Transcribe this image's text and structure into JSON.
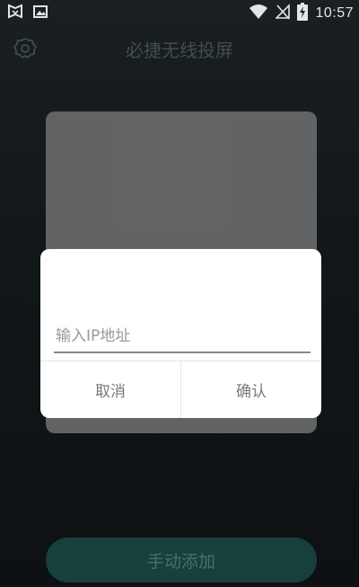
{
  "status_bar": {
    "time": "10:57",
    "icons": [
      "app-shield-icon",
      "image-icon",
      "wifi-icon",
      "no-signal-icon",
      "battery-charging-icon"
    ]
  },
  "header": {
    "title": "必捷无线投屏",
    "settings_icon": "gear-icon"
  },
  "dialog": {
    "ip_placeholder": "输入IP地址",
    "ip_value": "",
    "cancel_label": "取消",
    "confirm_label": "确认"
  },
  "footer": {
    "add_label": "手动添加"
  },
  "colors": {
    "background": "#14191c",
    "card": "#6e6f70",
    "accent_button": "#17403d",
    "accent_text": "#4b6e6a"
  }
}
